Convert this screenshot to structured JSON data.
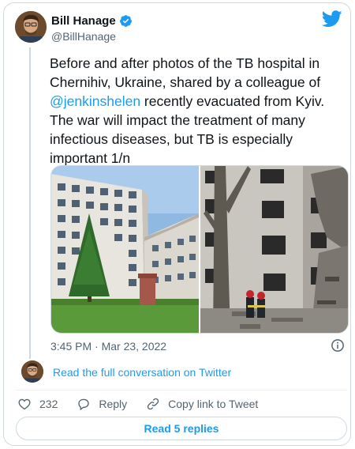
{
  "author": {
    "name": "Bill Hanage",
    "handle": "@BillHanage",
    "verified": true
  },
  "tweet": {
    "text_before_mention": "Before and after photos of the TB hospital in Chernihiv, Ukraine, shared by a colleague of ",
    "mention": "@jenkinshelen",
    "text_after_mention": " recently evacuated from Kyiv. The war will impact the treatment of many infectious diseases, but TB is especially important 1/n",
    "timestamp": "3:45 PM · Mar 23, 2022"
  },
  "media": [
    {
      "semantic": "hospital-before-photo"
    },
    {
      "semantic": "hospital-after-photo"
    }
  ],
  "conversation": {
    "link_label": "Read the full conversation on Twitter"
  },
  "actions": {
    "like_count": "232",
    "reply_label": "Reply",
    "copy_label": "Copy link to Tweet"
  },
  "replies_button": {
    "label": "Read 5 replies"
  },
  "colors": {
    "accent": "#1d9bf0",
    "text": "#0f1419",
    "muted": "#536471",
    "border": "#cfd9de"
  },
  "icons": [
    "verified-badge-icon",
    "twitter-bird-icon",
    "info-icon",
    "heart-icon",
    "reply-bubble-icon",
    "link-icon"
  ]
}
